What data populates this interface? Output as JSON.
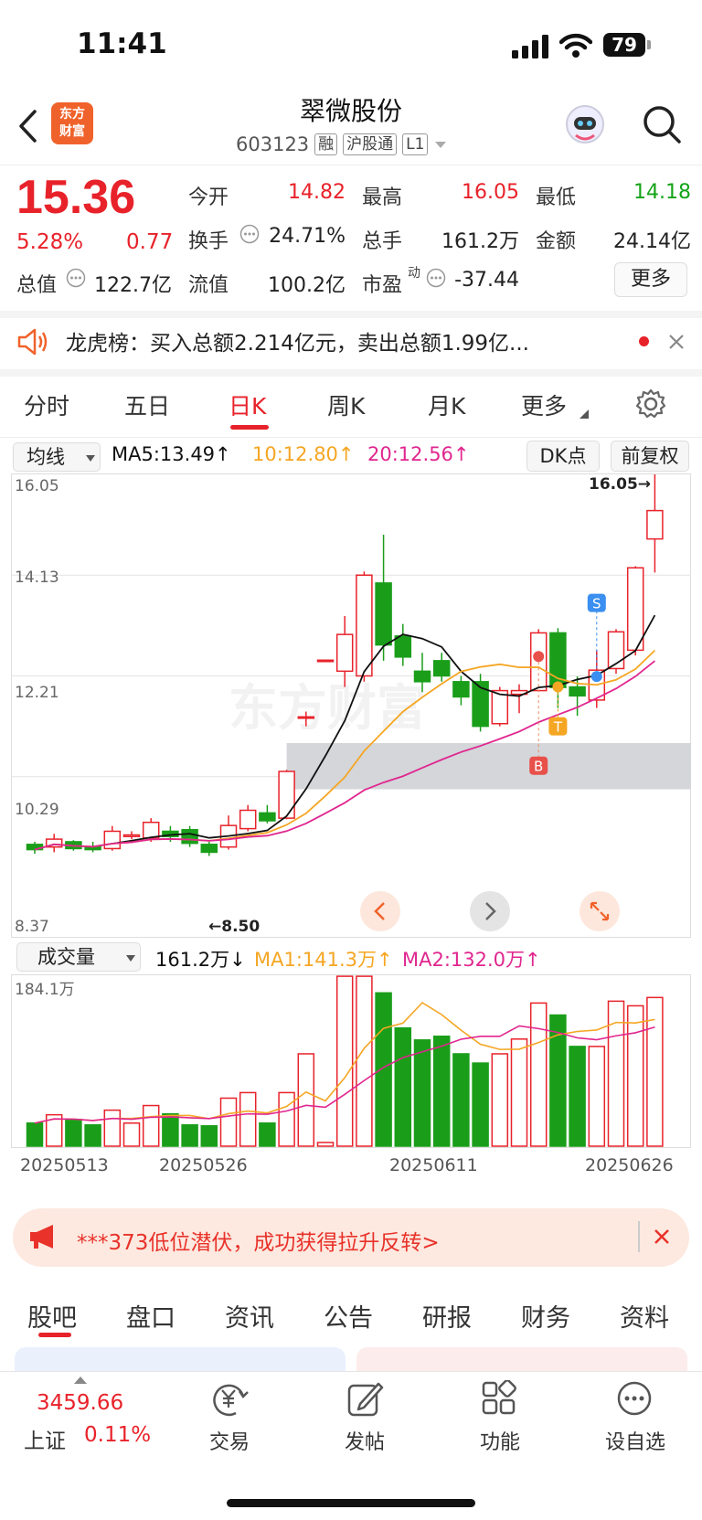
{
  "status": {
    "time": "11:41",
    "battery": "79"
  },
  "header": {
    "logo_line1": "东方",
    "logo_line2": "财富",
    "title": "翠微股份",
    "code": "603123",
    "tags": [
      "融",
      "沪股通",
      "L1"
    ]
  },
  "quote": {
    "price": "15.36",
    "change_pct": "5.28%",
    "change": "0.77",
    "rows": [
      [
        {
          "label": "今开",
          "value": "14.82",
          "color": "red"
        },
        {
          "label": "最高",
          "value": "16.05",
          "color": "red"
        },
        {
          "label": "最低",
          "value": "14.18",
          "color": "green"
        }
      ],
      [
        {
          "label": "换手",
          "value": "24.71%",
          "color": "dark"
        },
        {
          "label": "总手",
          "value": "161.2万",
          "color": "dark"
        },
        {
          "label": "金额",
          "value": "24.14亿",
          "color": "dark"
        }
      ],
      [
        {
          "label": "流值",
          "value": "100.2亿",
          "color": "dark"
        },
        {
          "label": "市盈",
          "value": "-37.44",
          "color": "dark"
        }
      ]
    ],
    "total_value_label": "总值",
    "total_value": "122.7亿",
    "pe_superscript": "动",
    "more_label": "更多"
  },
  "notice": {
    "text": "龙虎榜：买入总额2.214亿元，卖出总额1.99亿..."
  },
  "period_tabs": [
    "分时",
    "五日",
    "日K",
    "周K",
    "月K",
    "更多"
  ],
  "active_period": "日K",
  "kline": {
    "indicator_select": "均线",
    "ma5": "MA5:13.49↑",
    "ma10": "10:12.80↑",
    "ma20": "20:12.56↑",
    "dk_label": "DK点",
    "adjust_label": "前复权",
    "y_labels": [
      "16.05",
      "14.13",
      "12.21",
      "10.29",
      "8.37"
    ],
    "high_marker": "16.05→",
    "low_marker": "←8.50",
    "signal_s": "S",
    "signal_b": "B",
    "signal_t": "T",
    "watermark": "东方财富"
  },
  "volume": {
    "select": "成交量",
    "current": "161.2万↓",
    "ma1": "MA1:141.3万↑",
    "ma2": "MA2:132.0万↑",
    "top_label": "184.1万"
  },
  "dates": [
    "20250513",
    "20250526",
    "20250611",
    "20250626"
  ],
  "chart_data": {
    "type": "candlestick",
    "ylim": [
      8.37,
      16.05
    ],
    "candles": [
      {
        "o": 9.0,
        "c": 8.9,
        "h": 9.05,
        "l": 8.82
      },
      {
        "o": 8.95,
        "c": 9.1,
        "h": 9.2,
        "l": 8.85
      },
      {
        "o": 9.05,
        "c": 8.92,
        "h": 9.08,
        "l": 8.88
      },
      {
        "o": 8.95,
        "c": 8.9,
        "h": 9.05,
        "l": 8.85
      },
      {
        "o": 8.92,
        "c": 9.25,
        "h": 9.35,
        "l": 8.88
      },
      {
        "o": 9.15,
        "c": 9.18,
        "h": 9.25,
        "l": 9.1
      },
      {
        "o": 9.12,
        "c": 9.42,
        "h": 9.5,
        "l": 9.05
      },
      {
        "o": 9.25,
        "c": 9.15,
        "h": 9.35,
        "l": 9.05
      },
      {
        "o": 9.28,
        "c": 9.02,
        "h": 9.35,
        "l": 8.95
      },
      {
        "o": 9.0,
        "c": 8.85,
        "h": 9.05,
        "l": 8.78
      },
      {
        "o": 8.95,
        "c": 9.36,
        "h": 9.55,
        "l": 8.9
      },
      {
        "o": 9.3,
        "c": 9.65,
        "h": 9.75,
        "l": 9.25
      },
      {
        "o": 9.6,
        "c": 9.45,
        "h": 9.75,
        "l": 9.4
      },
      {
        "o": 9.5,
        "c": 10.39,
        "h": 10.42,
        "l": 9.48
      },
      {
        "o": 11.43,
        "c": 11.43,
        "h": 11.53,
        "l": 11.25
      },
      {
        "o": 12.51,
        "c": 12.51,
        "h": 12.52,
        "l": 12.5
      },
      {
        "o": 12.3,
        "c": 13.0,
        "h": 13.35,
        "l": 12.0
      },
      {
        "o": 12.21,
        "c": 14.13,
        "h": 14.2,
        "l": 12.1
      },
      {
        "o": 13.98,
        "c": 12.8,
        "h": 14.9,
        "l": 12.5
      },
      {
        "o": 12.97,
        "c": 12.57,
        "h": 13.2,
        "l": 12.4
      },
      {
        "o": 12.3,
        "c": 12.1,
        "h": 12.65,
        "l": 11.9
      },
      {
        "o": 12.5,
        "c": 12.21,
        "h": 12.65,
        "l": 12.1
      },
      {
        "o": 12.1,
        "c": 11.81,
        "h": 12.21,
        "l": 11.65
      },
      {
        "o": 12.1,
        "c": 11.25,
        "h": 12.25,
        "l": 11.15
      },
      {
        "o": 11.3,
        "c": 11.93,
        "h": 12.0,
        "l": 11.25
      },
      {
        "o": 11.86,
        "c": 11.93,
        "h": 12.05,
        "l": 11.5
      },
      {
        "o": 11.93,
        "c": 13.03,
        "h": 13.1,
        "l": 11.93
      },
      {
        "o": 13.03,
        "c": 11.99,
        "h": 13.12,
        "l": 11.6
      },
      {
        "o": 12.0,
        "c": 11.83,
        "h": 12.2,
        "l": 11.45
      },
      {
        "o": 11.75,
        "c": 12.32,
        "h": 12.7,
        "l": 11.6
      },
      {
        "o": 12.35,
        "c": 13.05,
        "h": 13.1,
        "l": 12.25
      },
      {
        "o": 12.7,
        "c": 14.27,
        "h": 14.3,
        "l": 12.6
      },
      {
        "o": 14.82,
        "c": 15.36,
        "h": 16.05,
        "l": 14.18
      }
    ],
    "volume_values": [
      25,
      34,
      29,
      23,
      39,
      25,
      44,
      35,
      23,
      22,
      52,
      58,
      25,
      58,
      100,
      4,
      184,
      184,
      166,
      128,
      115,
      119,
      100,
      90,
      100,
      116,
      155,
      142,
      108,
      108,
      157,
      152,
      161
    ],
    "volume_ylim": [
      0,
      184.1
    ]
  },
  "ad": {
    "text": "***373低位潜伏，成功获得拉升反转>"
  },
  "bottom_tabs": [
    "股吧",
    "盘口",
    "资讯",
    "公告",
    "研报",
    "财务",
    "资料"
  ],
  "active_bottom_tab": "股吧",
  "footer": {
    "index_value": "3459.66",
    "index_name": "上证",
    "index_change": "0.11%",
    "items": [
      "交易",
      "发帖",
      "功能",
      "设自选"
    ]
  }
}
